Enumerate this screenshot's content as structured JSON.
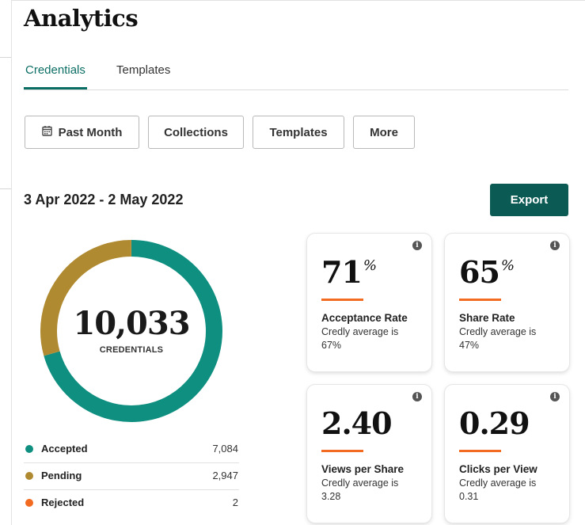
{
  "page": {
    "title": "Analytics"
  },
  "tabs": [
    {
      "label": "Credentials",
      "active": true
    },
    {
      "label": "Templates",
      "active": false
    }
  ],
  "filters": {
    "past_month": "Past Month",
    "collections": "Collections",
    "templates": "Templates",
    "more": "More"
  },
  "date_range": "3 Apr 2022 - 2 May 2022",
  "export_label": "Export",
  "donut": {
    "total": "10,033",
    "caption": "CREDENTIALS"
  },
  "legend": [
    {
      "label": "Accepted",
      "value": "7,084",
      "color": "#0f8f80"
    },
    {
      "label": "Pending",
      "value": "2,947",
      "color": "#b08a30"
    },
    {
      "label": "Rejected",
      "value": "2",
      "color": "#f26b21"
    }
  ],
  "colors": {
    "accent": "#0b6e64",
    "export_button": "#0b5b54",
    "metric_bar": "#f26b21"
  },
  "chart_data": {
    "type": "pie",
    "categories": [
      "Accepted",
      "Pending",
      "Rejected"
    ],
    "values": [
      7084,
      2947,
      2
    ],
    "colors": [
      "#0f8f80",
      "#b08a30",
      "#f26b21"
    ],
    "title": "",
    "center_value": "10,033",
    "center_label": "CREDENTIALS"
  },
  "metrics": {
    "acceptance": {
      "value": "71",
      "unit": "%",
      "label": "Acceptance Rate",
      "sub": "Credly average is 67%"
    },
    "share": {
      "value": "65",
      "unit": "%",
      "label": "Share Rate",
      "sub": "Credly average is 47%"
    },
    "views": {
      "value": "2.40",
      "unit": "",
      "label": "Views per Share",
      "sub": "Credly average is 3.28"
    },
    "clicks": {
      "value": "0.29",
      "unit": "",
      "label": "Clicks per View",
      "sub": "Credly average is 0.31"
    }
  },
  "icons": {
    "calendar": "calendar-icon",
    "info": "info-icon"
  }
}
